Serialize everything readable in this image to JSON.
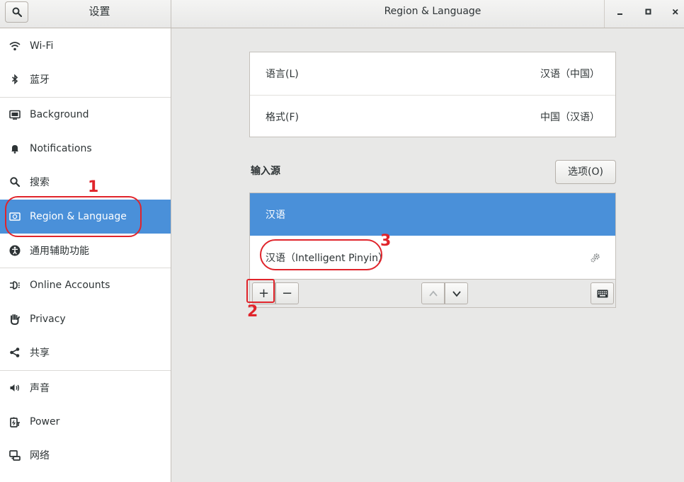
{
  "header": {
    "sidebar_title": "设置",
    "title": "Region & Language",
    "window_controls": [
      "minimize",
      "maximize",
      "close"
    ]
  },
  "sidebar": {
    "items": [
      {
        "label": "Wi-Fi",
        "icon": "wifi-icon"
      },
      {
        "label": "蓝牙",
        "icon": "bluetooth-icon"
      },
      {
        "label": "Background",
        "icon": "background-icon"
      },
      {
        "label": "Notifications",
        "icon": "bell-icon"
      },
      {
        "label": "搜索",
        "icon": "search-icon"
      },
      {
        "label": "Region & Language",
        "icon": "region-icon",
        "selected": true
      },
      {
        "label": "通用辅助功能",
        "icon": "accessibility-icon"
      },
      {
        "label": "Online Accounts",
        "icon": "online-accounts-icon"
      },
      {
        "label": "Privacy",
        "icon": "privacy-hand-icon"
      },
      {
        "label": "共享",
        "icon": "share-icon"
      },
      {
        "label": "声音",
        "icon": "speaker-icon"
      },
      {
        "label": "Power",
        "icon": "power-icon"
      },
      {
        "label": "网络",
        "icon": "network-icon"
      }
    ]
  },
  "settings": {
    "language_label": "语言(L)",
    "language_value": "汉语（中国）",
    "formats_label": "格式(F)",
    "formats_value": "中国（汉语）"
  },
  "input_sources": {
    "title": "输入源",
    "options_button": "选项(O)",
    "items": [
      {
        "label": "汉语",
        "selected": true
      },
      {
        "label": "汉语（Intelligent Pinyin）",
        "has_settings": true
      }
    ],
    "toolbar": {
      "add": "+",
      "remove": "−"
    }
  },
  "annotations": [
    "1",
    "2",
    "3"
  ],
  "colors": {
    "accent": "#4a90d9",
    "annotation": "#e0242b"
  }
}
